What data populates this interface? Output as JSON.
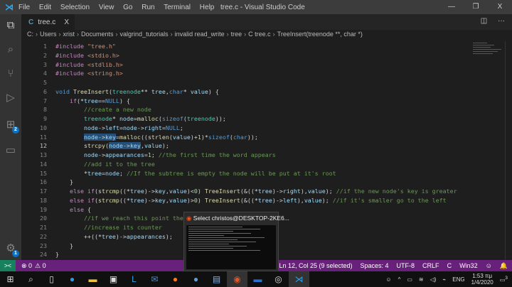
{
  "titlebar": {
    "menu": [
      "File",
      "Edit",
      "Selection",
      "View",
      "Go",
      "Run",
      "Terminal",
      "Help"
    ],
    "title": "tree.c - Visual Studio Code",
    "minimize": "—",
    "restore": "❐",
    "close": "X"
  },
  "activity": {
    "extensions_badge": "2",
    "settings_badge": "1"
  },
  "tab": {
    "icon": "C",
    "label": "tree.c",
    "close": "X",
    "split": "◫",
    "more": "···"
  },
  "breadcrumb": [
    "C:",
    "Users",
    "xrist",
    "Documents",
    "valgrind_tutorials",
    "invalid read_write",
    "tree",
    "C tree.c",
    "TreeInsert(treenode **, char *)"
  ],
  "code": [
    [
      [
        "ct",
        "#include "
      ],
      [
        "st",
        "\"tree.h\""
      ]
    ],
    [
      [
        "ct",
        "#include "
      ],
      [
        "st",
        "<stdio.h>"
      ]
    ],
    [
      [
        "ct",
        "#include "
      ],
      [
        "st",
        "<stdlib.h>"
      ]
    ],
    [
      [
        "ct",
        "#include "
      ],
      [
        "st",
        "<string.h>"
      ]
    ],
    [],
    [
      [
        "kw",
        "void "
      ],
      [
        "fn",
        "TreeInsert"
      ],
      [
        "",
        "("
      ],
      [
        "ty",
        "treenode"
      ],
      [
        "",
        "** "
      ],
      [
        "va",
        "tree"
      ],
      [
        "",
        ","
      ],
      [
        "kw",
        "char"
      ],
      [
        "",
        "* "
      ],
      [
        "va",
        "value"
      ],
      [
        "",
        ") {"
      ]
    ],
    [
      [
        "",
        "    "
      ],
      [
        "ct",
        "if"
      ],
      [
        "",
        "(*"
      ],
      [
        "va",
        "tree"
      ],
      [
        "",
        "=="
      ],
      [
        "kw",
        "NULL"
      ],
      [
        "",
        ") {"
      ]
    ],
    [
      [
        "",
        "        "
      ],
      [
        "cm",
        "//create a new node"
      ]
    ],
    [
      [
        "",
        "        "
      ],
      [
        "ty",
        "treenode"
      ],
      [
        "",
        "* "
      ],
      [
        "va",
        "node"
      ],
      [
        "",
        "="
      ],
      [
        "fn",
        "malloc"
      ],
      [
        "",
        "("
      ],
      [
        "kw",
        "sizeof"
      ],
      [
        "",
        "("
      ],
      [
        "ty",
        "treenode"
      ],
      [
        "",
        "));"
      ]
    ],
    [
      [
        "",
        "        "
      ],
      [
        "va",
        "node"
      ],
      [
        "",
        "->"
      ],
      [
        "va",
        "left"
      ],
      [
        "",
        "="
      ],
      [
        "va",
        "node"
      ],
      [
        "",
        "->"
      ],
      [
        "va",
        "right"
      ],
      [
        "",
        "="
      ],
      [
        "kw",
        "NULL"
      ],
      [
        "",
        ";"
      ]
    ],
    [
      [
        "",
        "        "
      ],
      [
        "va sel",
        "node"
      ],
      [
        "sel",
        "->"
      ],
      [
        "va sel",
        "key"
      ],
      [
        "",
        "="
      ],
      [
        "fn",
        "malloc"
      ],
      [
        "",
        "(("
      ],
      [
        "fn",
        "strlen"
      ],
      [
        "",
        "("
      ],
      [
        "va",
        "value"
      ],
      [
        "",
        ")+"
      ],
      [
        "nu",
        "1"
      ],
      [
        "",
        ")*"
      ],
      [
        "kw",
        "sizeof"
      ],
      [
        "",
        "("
      ],
      [
        "kw",
        "char"
      ],
      [
        "",
        "));"
      ]
    ],
    [
      [
        "",
        "        "
      ],
      [
        "fn",
        "strcpy"
      ],
      [
        "",
        "("
      ],
      [
        "va sel",
        "node"
      ],
      [
        "sel",
        "->"
      ],
      [
        "va sel",
        "key"
      ],
      [
        "",
        ","
      ],
      [
        "va",
        "value"
      ],
      [
        "",
        ");"
      ]
    ],
    [
      [
        "",
        "        "
      ],
      [
        "va",
        "node"
      ],
      [
        "",
        "->"
      ],
      [
        "va",
        "appearances"
      ],
      [
        "",
        "="
      ],
      [
        "nu",
        "1"
      ],
      [
        "",
        "; "
      ],
      [
        "cm",
        "//the first time the word appears"
      ]
    ],
    [
      [
        "",
        "        "
      ],
      [
        "cm",
        "//add it to the tree"
      ]
    ],
    [
      [
        "",
        "        *"
      ],
      [
        "va",
        "tree"
      ],
      [
        "",
        "="
      ],
      [
        "va",
        "node"
      ],
      [
        "",
        "; "
      ],
      [
        "cm",
        "//If the subtree is empty the node will be put at it's root"
      ]
    ],
    [
      [
        "",
        "    }"
      ]
    ],
    [
      [
        "",
        "    "
      ],
      [
        "ct",
        "else if"
      ],
      [
        "",
        "("
      ],
      [
        "fn",
        "strcmp"
      ],
      [
        "",
        "((*"
      ],
      [
        "va",
        "tree"
      ],
      [
        "",
        ")->"
      ],
      [
        "va",
        "key"
      ],
      [
        "",
        ","
      ],
      [
        "va",
        "value"
      ],
      [
        "",
        ")<"
      ],
      [
        "nu",
        "0"
      ],
      [
        "",
        ") "
      ],
      [
        "fn",
        "TreeInsert"
      ],
      [
        "",
        "(&((*"
      ],
      [
        "va",
        "tree"
      ],
      [
        "",
        ")->"
      ],
      [
        "va",
        "right"
      ],
      [
        "",
        "),"
      ],
      [
        "va",
        "value"
      ],
      [
        "",
        "); "
      ],
      [
        "cm",
        "//if the new node's key is greater"
      ]
    ],
    [
      [
        "",
        "    "
      ],
      [
        "ct",
        "else if"
      ],
      [
        "",
        "("
      ],
      [
        "fn",
        "strcmp"
      ],
      [
        "",
        "((*"
      ],
      [
        "va",
        "tree"
      ],
      [
        "",
        ")->"
      ],
      [
        "va",
        "key"
      ],
      [
        "",
        ","
      ],
      [
        "va",
        "value"
      ],
      [
        "",
        ")>"
      ],
      [
        "nu",
        "0"
      ],
      [
        "",
        ") "
      ],
      [
        "fn",
        "TreeInsert"
      ],
      [
        "",
        "(&((*"
      ],
      [
        "va",
        "tree"
      ],
      [
        "",
        ")->"
      ],
      [
        "va",
        "left"
      ],
      [
        "",
        "),"
      ],
      [
        "va",
        "value"
      ],
      [
        "",
        "); "
      ],
      [
        "cm",
        "//if it's smaller go to the left"
      ]
    ],
    [
      [
        "",
        "    "
      ],
      [
        "ct",
        "else"
      ],
      [
        "",
        " {"
      ]
    ],
    [
      [
        "",
        "        "
      ],
      [
        "cm",
        "//if we reach this point the"
      ]
    ],
    [
      [
        "",
        "        "
      ],
      [
        "cm",
        "//increase its counter"
      ]
    ],
    [
      [
        "",
        "        ++((*"
      ],
      [
        "va",
        "tree"
      ],
      [
        "",
        ")->"
      ],
      [
        "va",
        "appearances"
      ],
      [
        "",
        ");"
      ]
    ],
    [
      [
        "",
        "    }"
      ]
    ],
    [
      [
        "",
        "}"
      ]
    ]
  ],
  "status": {
    "remote": "><",
    "errors": "⊗ 0",
    "warnings": "⚠ 0",
    "position": "Ln 12, Col 25 (9 selected)",
    "spaces": "Spaces: 4",
    "encoding": "UTF-8",
    "eol": "CRLF",
    "language": "C",
    "platform": "Win32",
    "feedback": "☺",
    "bell": "🔔"
  },
  "popup": {
    "title": "Select christos@DESKTOP-2KE6..."
  },
  "taskbar": {
    "apps": [
      "start",
      "search",
      "task-view",
      "edge",
      "file-explorer",
      "store",
      "app-l",
      "mail",
      "firefox",
      "thunderbird",
      "notepad",
      "ubuntu",
      "app-chart",
      "obs",
      "vscode"
    ]
  },
  "tray": {
    "lang": "ENG",
    "time": "1:53 πμ",
    "date": "1/4/2020",
    "notif": "3"
  }
}
